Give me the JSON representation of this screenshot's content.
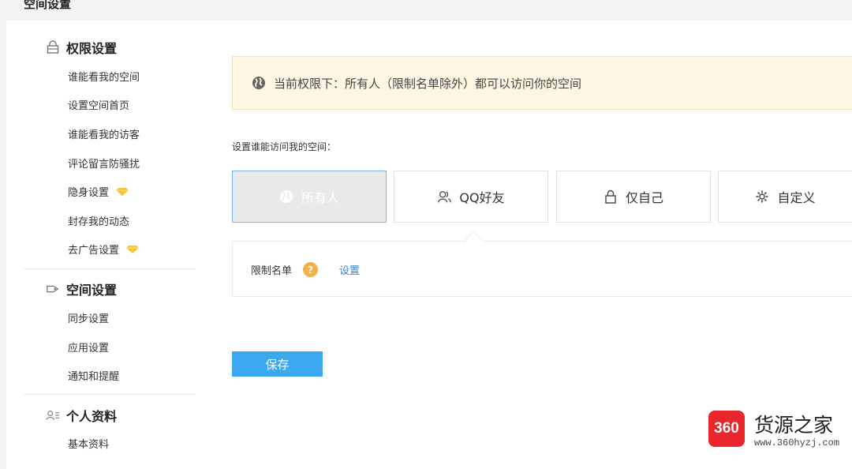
{
  "header": {
    "title": "空间设置"
  },
  "sidebar": {
    "groups": [
      {
        "title": "权限设置",
        "icon": "lock-icon",
        "items": [
          {
            "label": "谁能看我的空间"
          },
          {
            "label": "设置空间首页"
          },
          {
            "label": "谁能看我的访客"
          },
          {
            "label": "评论留言防骚扰"
          },
          {
            "label": "隐身设置",
            "badge": "vip-diamond-icon"
          },
          {
            "label": "封存我的动态"
          },
          {
            "label": "去广告设置",
            "badge": "vip-diamond-icon"
          }
        ]
      },
      {
        "title": "空间设置",
        "icon": "space-tag-icon",
        "items": [
          {
            "label": "同步设置"
          },
          {
            "label": "应用设置"
          },
          {
            "label": "通知和提醒"
          }
        ]
      },
      {
        "title": "个人资料",
        "icon": "profile-list-icon",
        "items": [
          {
            "label": "基本资料"
          }
        ]
      }
    ]
  },
  "main": {
    "notice": "当前权限下：所有人（限制名单除外）都可以访问你的空间",
    "access_label": "设置谁能访问我的空间：",
    "options": [
      {
        "label": "所有人",
        "icon": "globe-icon",
        "selected": true
      },
      {
        "label": "QQ好友",
        "icon": "friends-icon",
        "selected": false
      },
      {
        "label": "仅自己",
        "icon": "lock-icon",
        "selected": false
      },
      {
        "label": "自定义",
        "icon": "gear-icon",
        "selected": false
      }
    ],
    "blacklist": {
      "label": "限制名单",
      "help": "?",
      "link": "设置"
    },
    "save_label": "保存"
  },
  "watermark": {
    "logo": "360",
    "title": "货源之家",
    "url": "www.360hyzj.com"
  },
  "colors": {
    "accent": "#3ba8f0",
    "notice_bg": "#fdf6e3",
    "selected_border": "#7fb6e8",
    "vip": "#f7c531",
    "watermark_red": "#e8262c"
  }
}
